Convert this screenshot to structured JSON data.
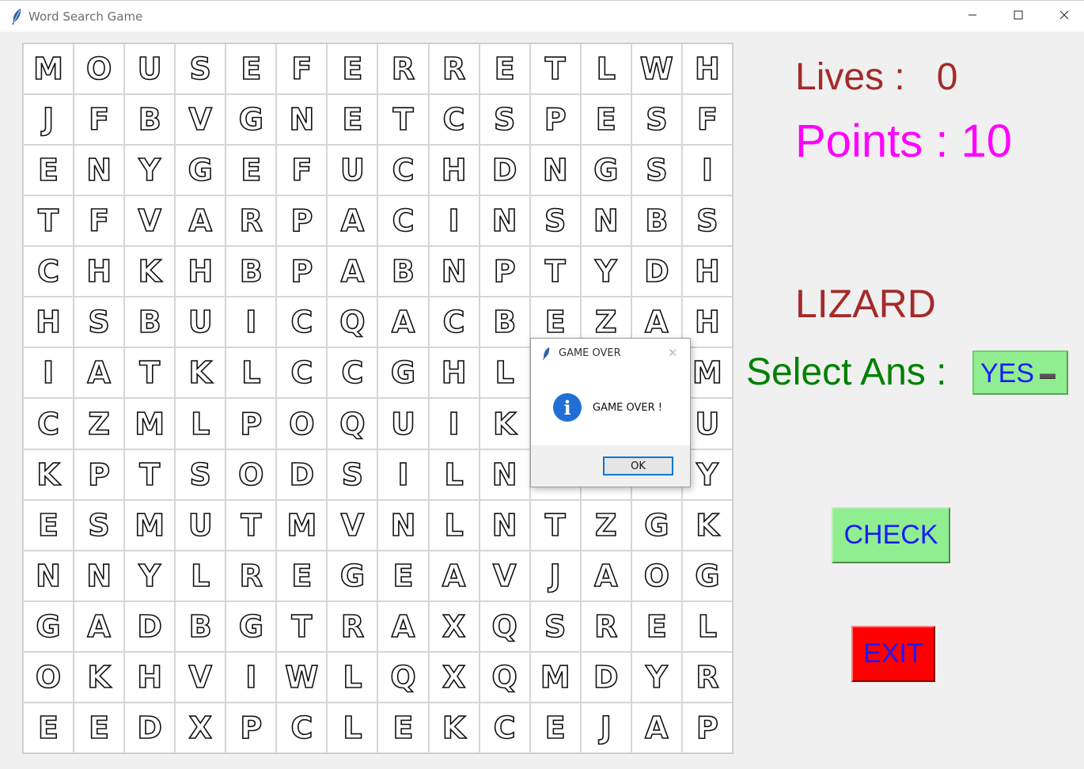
{
  "window": {
    "title": "Word Search Game"
  },
  "grid": {
    "rows": [
      [
        "M",
        "O",
        "U",
        "S",
        "E",
        "F",
        "E",
        "R",
        "R",
        "E",
        "T",
        "L",
        "W",
        "H"
      ],
      [
        "J",
        "F",
        "B",
        "V",
        "G",
        "N",
        "E",
        "T",
        "C",
        "S",
        "P",
        "E",
        "S",
        "F"
      ],
      [
        "E",
        "N",
        "Y",
        "G",
        "E",
        "F",
        "U",
        "C",
        "H",
        "D",
        "N",
        "G",
        "S",
        "I"
      ],
      [
        "T",
        "F",
        "V",
        "A",
        "R",
        "P",
        "A",
        "C",
        "I",
        "N",
        "S",
        "N",
        "B",
        "S"
      ],
      [
        "C",
        "H",
        "K",
        "H",
        "B",
        "P",
        "A",
        "B",
        "N",
        "P",
        "T",
        "Y",
        "D",
        "H"
      ],
      [
        "H",
        "S",
        "B",
        "U",
        "I",
        "C",
        "Q",
        "A",
        "C",
        "B",
        "E",
        "Z",
        "A",
        "H"
      ],
      [
        "I",
        "A",
        "T",
        "K",
        "L",
        "C",
        "C",
        "G",
        "H",
        "L",
        "",
        "",
        "",
        "M"
      ],
      [
        "C",
        "Z",
        "M",
        "L",
        "P",
        "O",
        "Q",
        "U",
        "I",
        "K",
        "",
        "",
        "",
        "U"
      ],
      [
        "K",
        "P",
        "T",
        "S",
        "O",
        "D",
        "S",
        "I",
        "L",
        "N",
        "",
        "",
        "",
        "Y"
      ],
      [
        "E",
        "S",
        "M",
        "U",
        "T",
        "M",
        "V",
        "N",
        "L",
        "N",
        "T",
        "Z",
        "G",
        "K"
      ],
      [
        "N",
        "N",
        "Y",
        "L",
        "R",
        "E",
        "G",
        "E",
        "A",
        "V",
        "J",
        "A",
        "O",
        "G"
      ],
      [
        "G",
        "A",
        "D",
        "B",
        "G",
        "T",
        "R",
        "A",
        "X",
        "Q",
        "S",
        "R",
        "E",
        "L"
      ],
      [
        "O",
        "K",
        "H",
        "V",
        "I",
        "W",
        "L",
        "Q",
        "X",
        "Q",
        "M",
        "D",
        "Y",
        "R"
      ],
      [
        "E",
        "E",
        "D",
        "X",
        "P",
        "C",
        "L",
        "E",
        "K",
        "C",
        "E",
        "J",
        "A",
        "P"
      ]
    ]
  },
  "panel": {
    "lives_label": "Lives :   0",
    "points_label": "Points : 10",
    "current_word": "LIZARD",
    "select_label": "Select Ans :",
    "select_value": "YES",
    "check_label": "CHECK",
    "exit_label": "EXIT"
  },
  "dialog": {
    "title": "GAME OVER",
    "message": "GAME OVER !",
    "ok_label": "OK"
  }
}
